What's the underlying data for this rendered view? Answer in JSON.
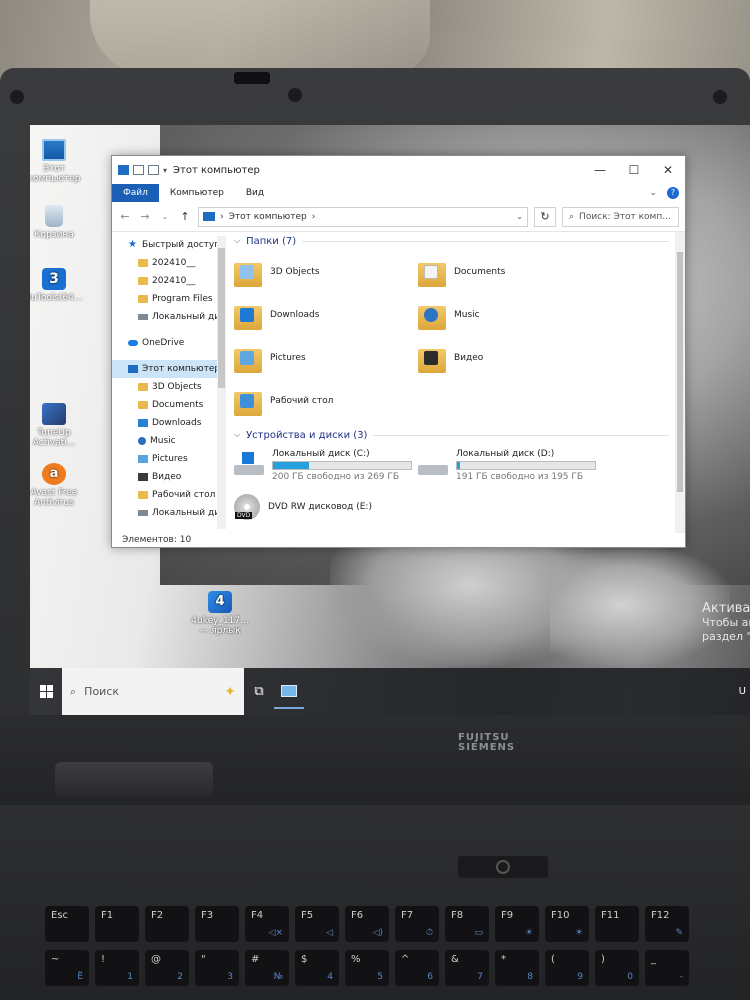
{
  "desktop": {
    "icons": [
      {
        "label": "Этот компьютер"
      },
      {
        "label": "Корзина"
      },
      {
        "label": "3uTools(64..."
      },
      {
        "label": "TuneUp Activati..."
      },
      {
        "label": "Avast Free Antivirus"
      },
      {
        "label": "4ukey_117... — ярлык"
      }
    ],
    "activation": {
      "line1": "Актива",
      "line2": "Чтобы ак",
      "line3": "раздел \""
    }
  },
  "explorer": {
    "title": "Этот компьютер",
    "ribbon_tabs": [
      "Файл",
      "Компьютер",
      "Вид"
    ],
    "address": {
      "path": "Этот компьютер"
    },
    "search_placeholder": "Поиск: Этот комп...",
    "nav": [
      {
        "label": "Быстрый доступ",
        "icon": "star-icon",
        "level": 0
      },
      {
        "label": "202410__",
        "icon": "folder-icon",
        "level": 1
      },
      {
        "label": "202410__",
        "icon": "folder-icon",
        "level": 1
      },
      {
        "label": "Program Files",
        "icon": "folder-icon",
        "level": 1
      },
      {
        "label": "Локальный дис",
        "icon": "drive-icon",
        "level": 1
      },
      {
        "label": "OneDrive",
        "icon": "cloud-icon",
        "level": 0
      },
      {
        "label": "Этот компьютер",
        "icon": "computer-icon",
        "level": 0,
        "selected": true
      },
      {
        "label": "3D Objects",
        "icon": "folder-icon",
        "level": 1
      },
      {
        "label": "Documents",
        "icon": "folder-icon",
        "level": 1
      },
      {
        "label": "Downloads",
        "icon": "download-icon",
        "level": 1
      },
      {
        "label": "Music",
        "icon": "music-icon",
        "level": 1
      },
      {
        "label": "Pictures",
        "icon": "pictures-icon",
        "level": 1
      },
      {
        "label": "Видео",
        "icon": "video-icon",
        "level": 1
      },
      {
        "label": "Рабочий стол",
        "icon": "folder-icon",
        "level": 1
      },
      {
        "label": "Локальный дис",
        "icon": "drive-icon",
        "level": 1
      }
    ],
    "folders_group": "Папки (7)",
    "folders": [
      {
        "name": "3D Objects",
        "glyph": "g-obj"
      },
      {
        "name": "Documents",
        "glyph": "g-doc"
      },
      {
        "name": "Downloads",
        "glyph": "g-down"
      },
      {
        "name": "Music",
        "glyph": "g-music"
      },
      {
        "name": "Pictures",
        "glyph": "g-pic"
      },
      {
        "name": "Видео",
        "glyph": "g-video"
      },
      {
        "name": "Рабочий стол",
        "glyph": "g-desk"
      }
    ],
    "devices_group": "Устройства и диски (3)",
    "drives": [
      {
        "name": "Локальный диск (C:)",
        "free": "200 ГБ свободно из 269 ГБ",
        "used_fraction": 0.26,
        "system": true
      },
      {
        "name": "Локальный диск (D:)",
        "free": "191 ГБ свободно из 195 ГБ",
        "used_fraction": 0.02,
        "system": false
      }
    ],
    "dvd": {
      "name": "DVD RW дисковод (E:)",
      "badge": "DVD"
    },
    "status": "Элементов: 10"
  },
  "taskbar": {
    "search_placeholder": "Поиск",
    "tray_text": "U"
  },
  "laptop": {
    "brand_top": "FUJITSU",
    "brand_bottom": "SIEMENS"
  },
  "keyboard": {
    "row1": [
      {
        "main": "Esc",
        "alt": ""
      },
      {
        "main": "F1",
        "alt": ""
      },
      {
        "main": "F2",
        "alt": ""
      },
      {
        "main": "F3",
        "alt": ""
      },
      {
        "main": "F4",
        "alt": "◁×"
      },
      {
        "main": "F5",
        "alt": "◁"
      },
      {
        "main": "F6",
        "alt": "◁)"
      },
      {
        "main": "F7",
        "alt": "⏱"
      },
      {
        "main": "F8",
        "alt": "▭"
      },
      {
        "main": "F9",
        "alt": "☀"
      },
      {
        "main": "F10",
        "alt": "☀"
      },
      {
        "main": "F11",
        "alt": ""
      },
      {
        "main": "F12",
        "alt": "✎"
      }
    ],
    "row2": [
      {
        "main": "~",
        "alt": "Ё"
      },
      {
        "main": "!",
        "alt": "1"
      },
      {
        "main": "@",
        "alt": "2"
      },
      {
        "main": "\"",
        "alt": "3"
      },
      {
        "main": "#",
        "alt": "№"
      },
      {
        "main": "$",
        "alt": "4"
      },
      {
        "main": "%",
        "alt": "5"
      },
      {
        "main": "^",
        "alt": "6"
      },
      {
        "main": "&",
        "alt": "7"
      },
      {
        "main": "*",
        "alt": "8"
      },
      {
        "main": "(",
        "alt": "9"
      },
      {
        "main": ")",
        "alt": "0"
      },
      {
        "main": "_",
        "alt": "-"
      }
    ]
  }
}
